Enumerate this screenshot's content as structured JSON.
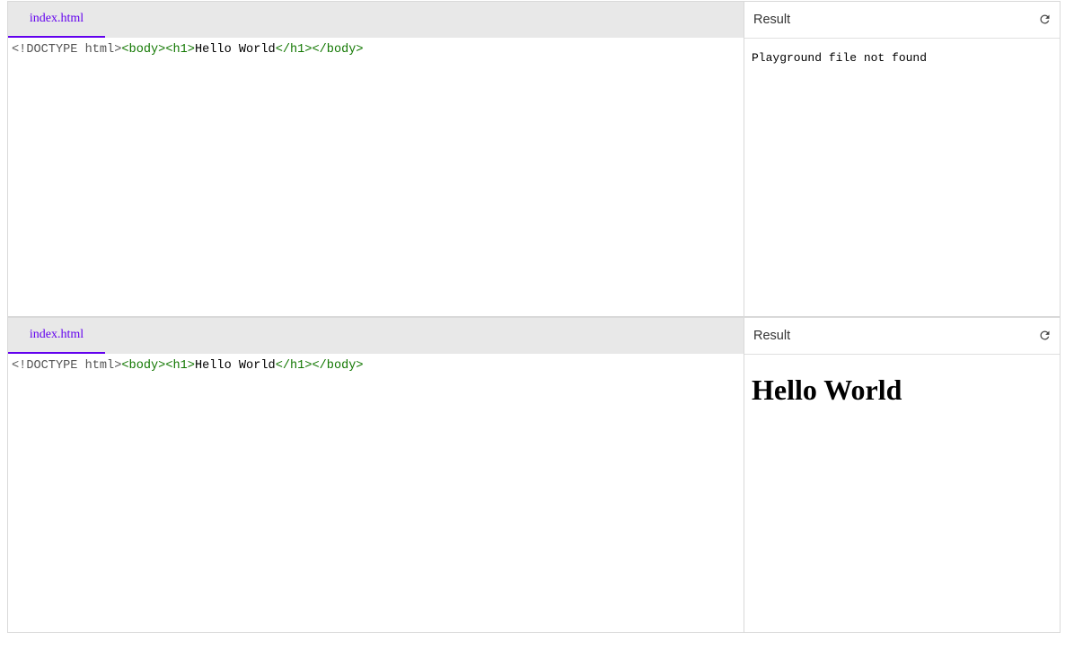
{
  "playgrounds": [
    {
      "tab_label": "index.html",
      "code": {
        "doctype": "<!DOCTYPE html>",
        "open_tags": "<body><h1>",
        "text": "Hello World",
        "close_tags": "</h1></body>"
      },
      "result": {
        "title": "Result",
        "message": "Playground file not found"
      }
    },
    {
      "tab_label": "index.html",
      "code": {
        "doctype": "<!DOCTYPE html>",
        "open_tags": "<body><h1>",
        "text": "Hello World",
        "close_tags": "</h1></body>"
      },
      "result": {
        "title": "Result",
        "heading": "Hello World"
      }
    }
  ],
  "icons": {
    "reload": "reload-icon"
  },
  "colors": {
    "accent": "#6200ee",
    "tag": "#117700",
    "doctype": "#555555",
    "tab_bar_bg": "#e8e8e8"
  }
}
